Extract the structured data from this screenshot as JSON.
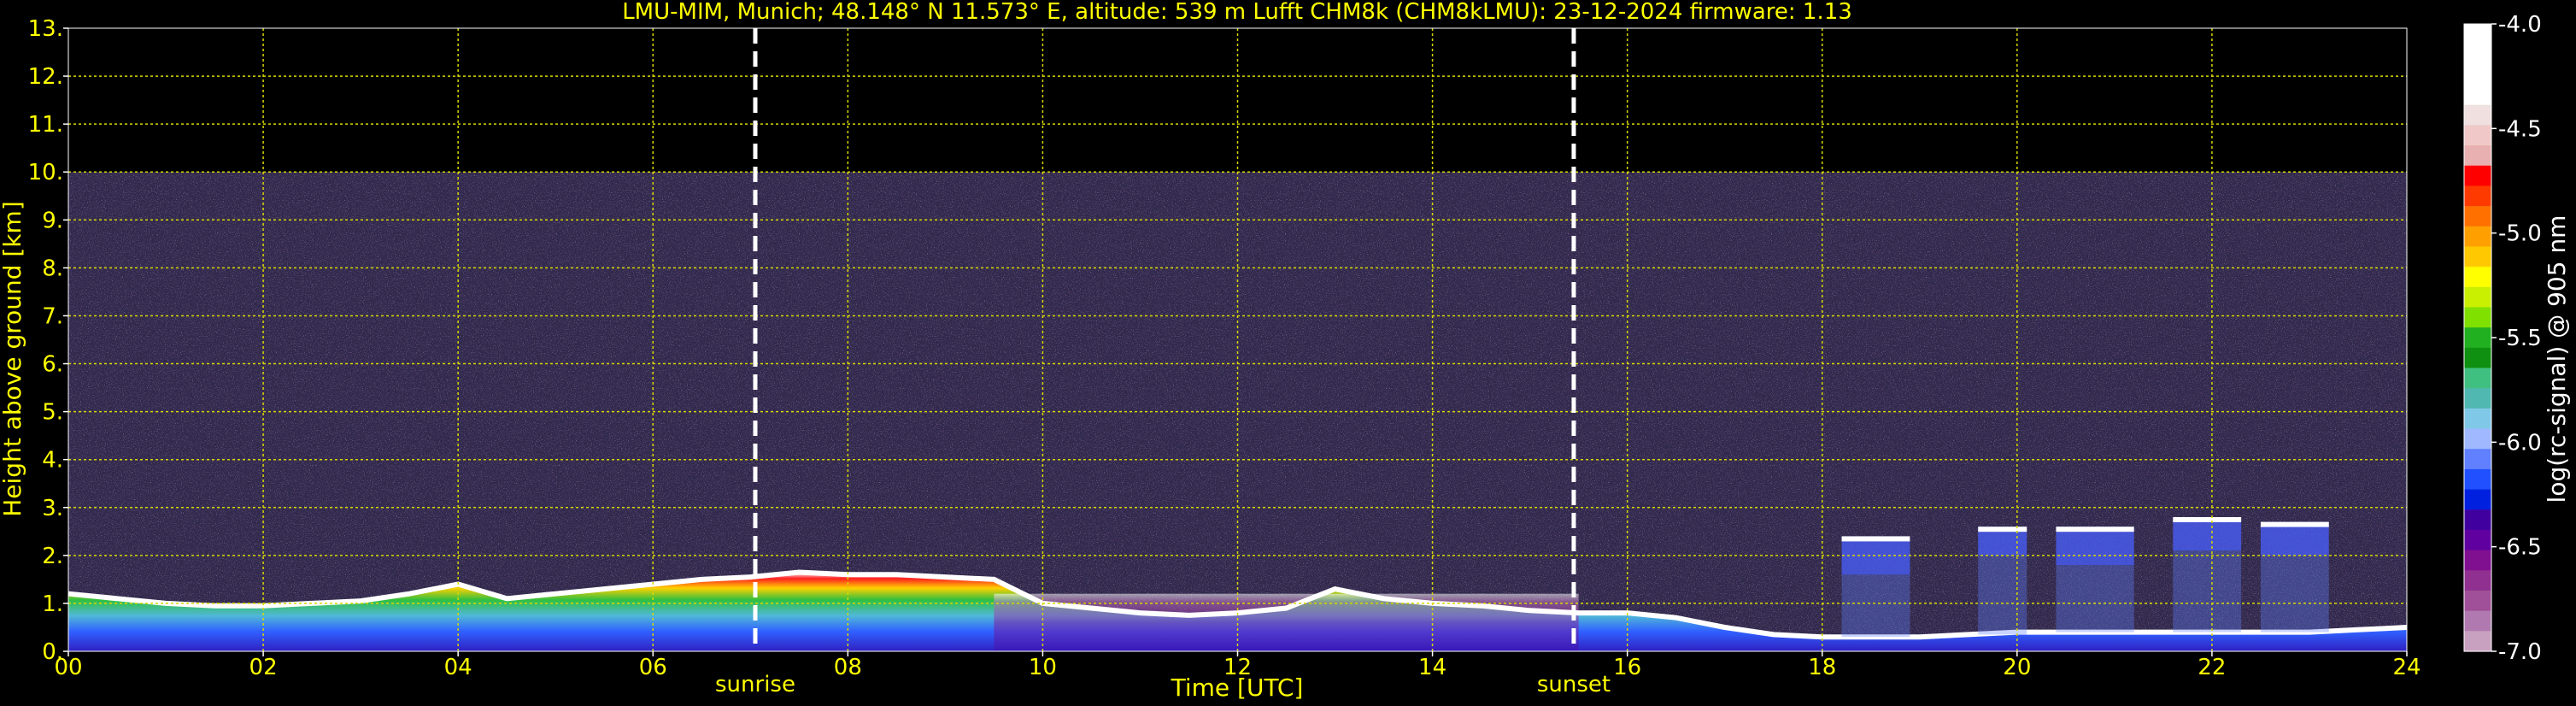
{
  "chart_data": {
    "type": "heatmap",
    "title": "LMU-MIM, Munich; 48.148° N 11.573° E, altitude: 539 m    Lufft CHM8k (CHM8kLMU): 23-12-2024    firmware: 1.13",
    "xlabel": "Time [UTC]",
    "ylabel": "Height above ground [km]",
    "xlim": [
      0,
      24
    ],
    "ylim": [
      0,
      13
    ],
    "x_ticks": [
      0,
      2,
      4,
      6,
      8,
      10,
      12,
      14,
      16,
      18,
      20,
      22,
      24
    ],
    "x_tick_labels": [
      "00",
      "02",
      "04",
      "06",
      "08",
      "10",
      "12",
      "14",
      "16",
      "18",
      "20",
      "22",
      "24"
    ],
    "y_ticks": [
      0,
      1,
      2,
      3,
      4,
      5,
      6,
      7,
      8,
      9,
      10,
      11,
      12,
      13
    ],
    "y_tick_labels": [
      "0.",
      "1.",
      "2.",
      "3.",
      "4.",
      "5.",
      "6.",
      "7.",
      "8.",
      "9.",
      "10.",
      "11.",
      "12.",
      "13."
    ],
    "grid": true,
    "data_top_km": 10,
    "markers": [
      {
        "label": "sunrise",
        "time": 7.05
      },
      {
        "label": "sunset",
        "time": 15.45
      }
    ],
    "colorbar": {
      "label": "log(rc-signal) @ 905 nm",
      "range": [
        -7.0,
        -4.0
      ],
      "ticks": [
        -4.0,
        -4.5,
        -5.0,
        -5.5,
        -6.0,
        -6.5,
        -7.0
      ],
      "tick_labels": [
        "-4.0",
        "-4.5",
        "-5.0",
        "-5.5",
        "-6.0",
        "-6.5",
        "-7.0"
      ],
      "colors": [
        "#ffffff",
        "#ffffff",
        "#ffffff",
        "#ffffff",
        "#f0e0e0",
        "#f0c8c8",
        "#e8b0b0",
        "#ff0000",
        "#ff3a00",
        "#ff7000",
        "#ffa000",
        "#ffc800",
        "#ffff00",
        "#c8f000",
        "#80e000",
        "#20b020",
        "#109010",
        "#40c080",
        "#50b8b0",
        "#80c8e8",
        "#a0b8ff",
        "#6080ff",
        "#2050ff",
        "#0020e0",
        "#4000a0",
        "#6000a0",
        "#801090",
        "#903090",
        "#a05098",
        "#b07ab0",
        "#c8a0c0"
      ]
    },
    "boundary_layer_top_km": {
      "time": [
        0,
        0.5,
        1,
        1.5,
        2,
        2.5,
        3,
        3.5,
        4,
        4.5,
        5,
        5.5,
        6,
        6.5,
        7,
        7.5,
        8,
        8.5,
        9,
        9.5,
        10,
        10.5,
        11,
        11.5,
        12,
        12.5,
        13,
        13.5,
        14,
        14.5,
        15,
        15.5,
        16,
        16.5,
        17,
        17.5,
        18,
        18.5,
        19,
        19.5,
        20,
        20.5,
        21,
        21.5,
        22,
        22.5,
        23,
        23.5,
        24
      ],
      "height": [
        1.2,
        1.1,
        1.0,
        0.95,
        0.95,
        1.0,
        1.05,
        1.2,
        1.4,
        1.1,
        1.2,
        1.3,
        1.4,
        1.5,
        1.55,
        1.65,
        1.6,
        1.6,
        1.55,
        1.5,
        1.0,
        0.9,
        0.8,
        0.75,
        0.8,
        0.9,
        1.3,
        1.1,
        1.0,
        0.95,
        0.85,
        0.8,
        0.8,
        0.7,
        0.5,
        0.35,
        0.3,
        0.3,
        0.3,
        0.35,
        0.4,
        0.4,
        0.4,
        0.4,
        0.4,
        0.4,
        0.4,
        0.45,
        0.5
      ]
    },
    "cloud_layers": [
      {
        "start": 18.2,
        "end": 18.9,
        "base_km": 1.6,
        "top_km": 2.4
      },
      {
        "start": 19.6,
        "end": 20.1,
        "base_km": 2.0,
        "top_km": 2.6
      },
      {
        "start": 20.4,
        "end": 21.2,
        "base_km": 1.8,
        "top_km": 2.6
      },
      {
        "start": 21.6,
        "end": 22.3,
        "base_km": 2.1,
        "top_km": 2.8
      },
      {
        "start": 22.5,
        "end": 23.2,
        "base_km": 2.0,
        "top_km": 2.7
      }
    ]
  }
}
